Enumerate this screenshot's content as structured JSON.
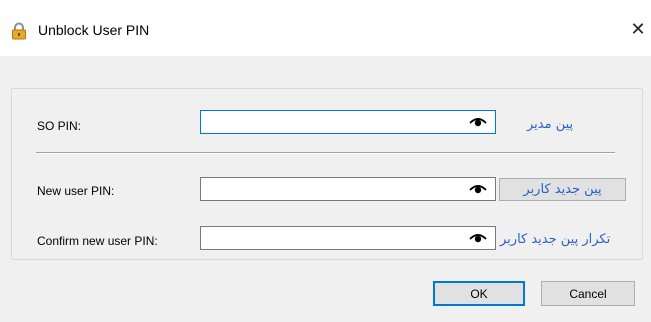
{
  "window": {
    "title": "Unblock User PIN",
    "close_glyph": "✕",
    "icon": "lock-icon"
  },
  "form": {
    "so_pin": {
      "label": "SO PIN:",
      "value": "",
      "persian_label": "پین مدیر"
    },
    "new_pin": {
      "label": "New user PIN:",
      "value": "",
      "persian_label": "پین جدید کاربر"
    },
    "confirm_pin": {
      "label": "Confirm new user PIN:",
      "value": "",
      "persian_label": "تکرار پین جدید کاربر"
    },
    "reveal_icon": "eye-icon"
  },
  "buttons": {
    "ok": "OK",
    "cancel": "Cancel"
  },
  "colors": {
    "dialog_bg": "#f0f0f0",
    "focus_border": "#0078d7",
    "persian_text": "#2a62c9"
  }
}
